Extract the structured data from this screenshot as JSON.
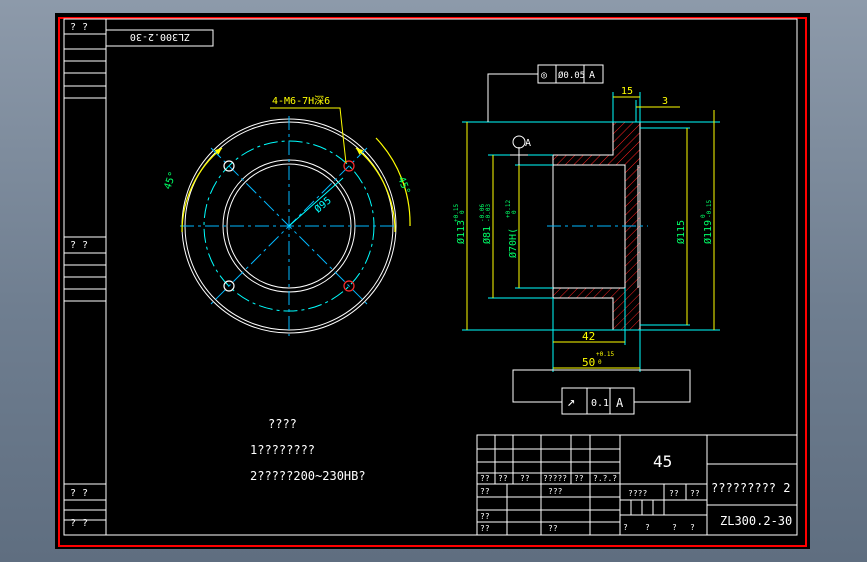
{
  "colors": {
    "sheet": "#000000",
    "frame_outer": "#ff0000",
    "frame_inner": "#ffffff",
    "part": "#ffffff",
    "dim": "#00ffff",
    "ann": "#ffff00",
    "green": "#00ff66",
    "center": "#00b8ff",
    "hatch": "#ff2020",
    "hole": "#ff3030"
  },
  "left_strip": {
    "top_label": "? ?",
    "mid_label": "? ?",
    "bottom_label_1": "? ?",
    "bottom_label_2": "? ?"
  },
  "drawing_code_box": "ZL300.2-30",
  "front_view": {
    "hole_callout": "4-M6-7H深6",
    "pcd_dim": "Ø95",
    "angle_left": "45°",
    "angle_right": "45°"
  },
  "section_view": {
    "datum_label": "A",
    "gdt_top": {
      "symbol": "◎",
      "tolerance": "Ø0.05",
      "datum": "A"
    },
    "gdt_bottom": {
      "symbol": "↗",
      "tolerance": "0.1",
      "datum": "A"
    },
    "dim_15": "15",
    "dim_3": "3",
    "dim_d113": "Ø113",
    "dim_d113_tol": "+0.15",
    "dim_d113_tol2": "0",
    "dim_d81": "Ø81",
    "dim_d81_tol": "-0.06",
    "dim_d81_tol2": "-0.03",
    "dim_d70": "Ø70H(",
    "dim_d70_tol": "+0.12",
    "dim_d70_tol2": "0",
    "dim_d115": "Ø115",
    "dim_d119": "Ø119",
    "dim_d119_tol": "0",
    "dim_d119_tol2": "-0.15",
    "dim_42": "42",
    "dim_50": "50",
    "dim_50_tol": "+0.15",
    "dim_50_tol2": "0"
  },
  "notes": {
    "title": "????",
    "line1": "1????????",
    "line2": "2?????200~230HB?"
  },
  "title_block": {
    "material": "45",
    "part_name": "????????? 2",
    "drawing_no": "ZL300.2-30",
    "row_labels": [
      "??",
      "??",
      "??",
      "?????",
      "??",
      "?.?.?"
    ],
    "r2_label": "??",
    "r2_label2": "???",
    "r3_label": "????",
    "r3_b": "??",
    "r3_c": "??",
    "r4_a": "??",
    "r5_a": "??",
    "r5_b": "??",
    "r5_c": "?",
    "r5_d": "?",
    "r5_e": "?",
    "r5_f": "?",
    "r5_g": "?"
  }
}
